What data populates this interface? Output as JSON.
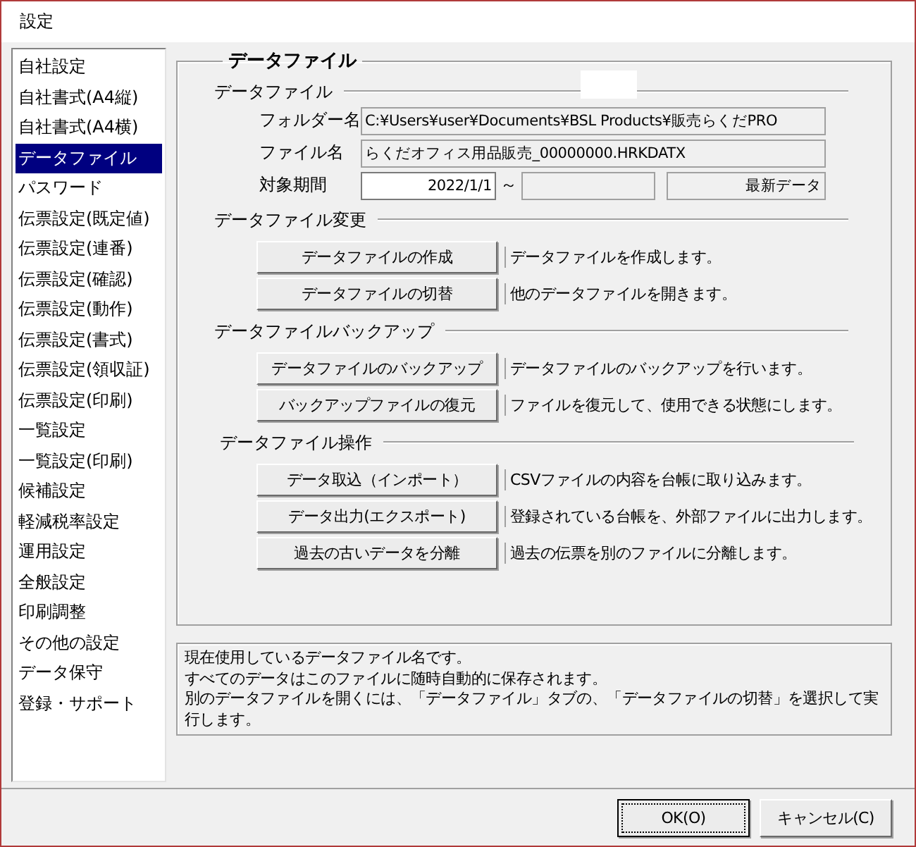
{
  "window": {
    "title": "設定"
  },
  "sidebar": {
    "items": [
      {
        "label": "自社設定",
        "selected": false
      },
      {
        "label": "自社書式(A4縦)",
        "selected": false
      },
      {
        "label": "自社書式(A4横)",
        "selected": false
      },
      {
        "label": "データファイル",
        "selected": true
      },
      {
        "label": "パスワード",
        "selected": false
      },
      {
        "label": "伝票設定(既定値)",
        "selected": false
      },
      {
        "label": "伝票設定(連番)",
        "selected": false
      },
      {
        "label": "伝票設定(確認)",
        "selected": false
      },
      {
        "label": "伝票設定(動作)",
        "selected": false
      },
      {
        "label": "伝票設定(書式)",
        "selected": false
      },
      {
        "label": "伝票設定(領収証)",
        "selected": false
      },
      {
        "label": "伝票設定(印刷)",
        "selected": false
      },
      {
        "label": "一覧設定",
        "selected": false
      },
      {
        "label": "一覧設定(印刷)",
        "selected": false
      },
      {
        "label": "候補設定",
        "selected": false
      },
      {
        "label": "軽減税率設定",
        "selected": false
      },
      {
        "label": "運用設定",
        "selected": false
      },
      {
        "label": "全般設定",
        "selected": false
      },
      {
        "label": "印刷調整",
        "selected": false
      },
      {
        "label": "その他の設定",
        "selected": false
      },
      {
        "label": "データ保守",
        "selected": false
      },
      {
        "label": "登録・サポート",
        "selected": false
      }
    ]
  },
  "panel": {
    "title": "データファイル",
    "sections": [
      {
        "kind": "fields",
        "title": "データファイル",
        "folder": {
          "label": "フォルダー名",
          "value": "C:¥Users¥user¥Documents¥BSL Products¥販売らくだPRO"
        },
        "file": {
          "label": "ファイル名",
          "value": "らくだオフィス用品販売_00000000.HRKDATX"
        },
        "period": {
          "label": "対象期間",
          "start": "2022/1/1",
          "separator": "～",
          "latest": "最新データ"
        }
      },
      {
        "kind": "actions",
        "title": "データファイル変更",
        "actions": [
          {
            "button": "データファイルの作成",
            "description": "データファイルを作成します。"
          },
          {
            "button": "データファイルの切替",
            "description": "他のデータファイルを開きます。"
          }
        ]
      },
      {
        "kind": "actions",
        "title": "データファイルバックアップ",
        "actions": [
          {
            "button": "データファイルのバックアップ",
            "description": "データファイルのバックアップを行います。"
          },
          {
            "button": "バックアップファイルの復元",
            "description": "ファイルを復元して、使用できる状態にします。"
          }
        ]
      },
      {
        "kind": "actions",
        "title": "データファイル操作",
        "actions": [
          {
            "button": "データ取込（インポート）",
            "description": "CSVファイルの内容を台帳に取り込みます。"
          },
          {
            "button": "データ出力(エクスポート)",
            "description": "登録されている台帳を、外部ファイルに出力します。"
          },
          {
            "button": "過去の古いデータを分離",
            "description": "過去の伝票を別のファイルに分離します。"
          }
        ]
      }
    ]
  },
  "info": [
    "現在使用しているデータファイル名です。",
    "すべてのデータはこのファイルに随時自動的に保存されます。",
    "別のデータファイルを開くには、「データファイル」タブの、「データファイルの切替」を選択して実行します。"
  ],
  "buttons": [
    {
      "label": "OK(O)",
      "kind": "default"
    },
    {
      "label": "キャンセル(C)",
      "kind": "normal"
    }
  ]
}
